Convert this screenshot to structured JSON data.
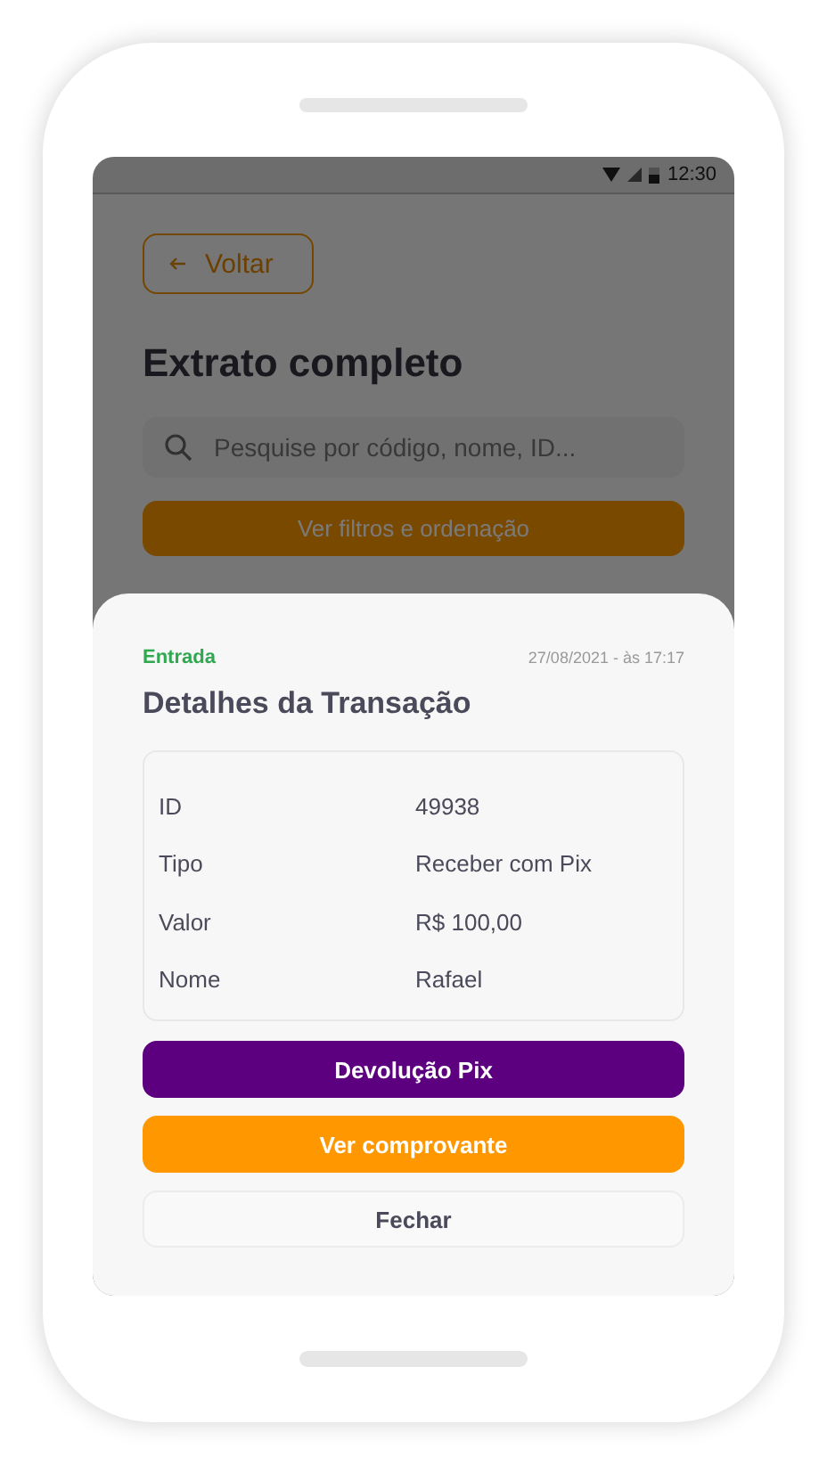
{
  "status_bar": {
    "time": "12:30"
  },
  "page": {
    "back_button": "Voltar",
    "title": "Extrato completo",
    "search": {
      "placeholder": "Pesquise por código, nome, ID..."
    },
    "filter_button": "Ver filtros e ordenação"
  },
  "sheet": {
    "tag": "Entrada",
    "date": "27/08/2021 - às 17:17",
    "title": "Detalhes da Transação",
    "details": [
      {
        "label": "ID",
        "value": "49938"
      },
      {
        "label": "Tipo",
        "value": "Receber com Pix"
      },
      {
        "label": "Valor",
        "value": "R$ 100,00"
      },
      {
        "label": "Nome",
        "value": "Rafael"
      }
    ],
    "buttons": [
      {
        "label": "Devolução Pix",
        "kind": "primary"
      },
      {
        "label": "Ver comprovante",
        "kind": "accent"
      },
      {
        "label": "Fechar",
        "kind": "plain"
      }
    ]
  }
}
